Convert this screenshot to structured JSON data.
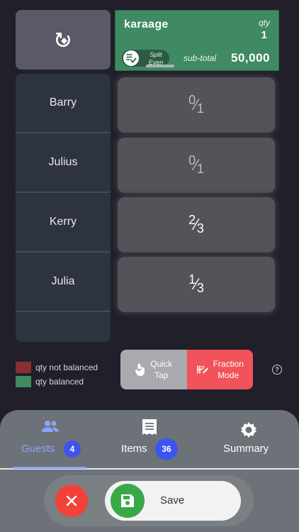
{
  "item": {
    "name": "karaage",
    "qty_label": "qty",
    "qty": "1",
    "split_line1": "Split",
    "split_line2": "Even",
    "subtotal_label": "sub-total",
    "subtotal": "50,000"
  },
  "guests": [
    {
      "name": "Barry",
      "num": "0",
      "den": "1",
      "state": "dim"
    },
    {
      "name": "Julius",
      "num": "0",
      "den": "1",
      "state": "dim"
    },
    {
      "name": "Kerry",
      "num": "2",
      "den": "3",
      "state": "bright"
    },
    {
      "name": "Julia",
      "num": "1",
      "den": "3",
      "state": "bright"
    }
  ],
  "legend": {
    "not_balanced": "qty not balanced",
    "balanced": "qty balanced",
    "not_balanced_color": "#8b2e34",
    "balanced_color": "#3f8a62"
  },
  "mode": {
    "quick_line1": "Quick",
    "quick_line2": "Tap",
    "fraction_line1": "Fraction",
    "fraction_line2": "Mode",
    "active": "fraction"
  },
  "help": "?",
  "tabs": {
    "guests_label": "Guests",
    "guests_count": "4",
    "items_label": "Items",
    "items_count": "36",
    "summary_label": "Summary",
    "active": "guests",
    "accent": "#8ea2ff",
    "badge_color": "#3d55ee"
  },
  "actions": {
    "save_label": "Save"
  }
}
